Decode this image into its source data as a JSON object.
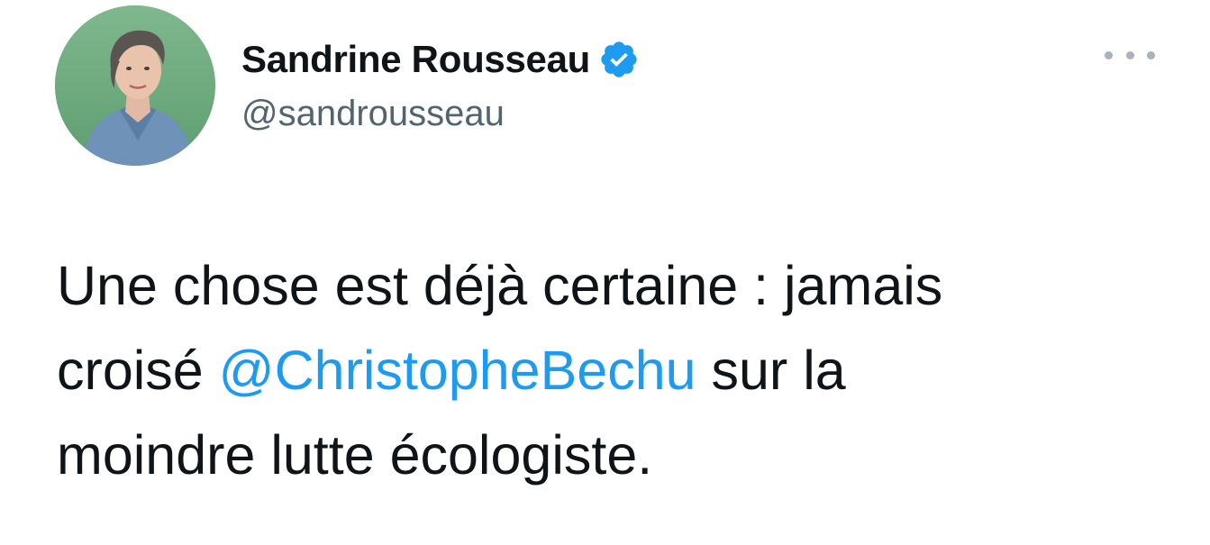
{
  "author": {
    "display_name": "Sandrine Rousseau",
    "handle": "@sandrousseau",
    "verified": true,
    "avatar_icon": "profile-photo-woman-denim-shirt"
  },
  "menu": {
    "icon": "more-horizontal-icon"
  },
  "tweet": {
    "line1": "Une chose est déjà certaine : jamais",
    "line2_before": "croisé ",
    "mention": "@ChristopheBechu",
    "line2_after": " sur la",
    "line3": "moindre lutte écologiste."
  },
  "colors": {
    "link": "#1d9bf0",
    "verified_badge": "#1d9bf0",
    "text": "#0f1419",
    "secondary_text": "#536471"
  }
}
